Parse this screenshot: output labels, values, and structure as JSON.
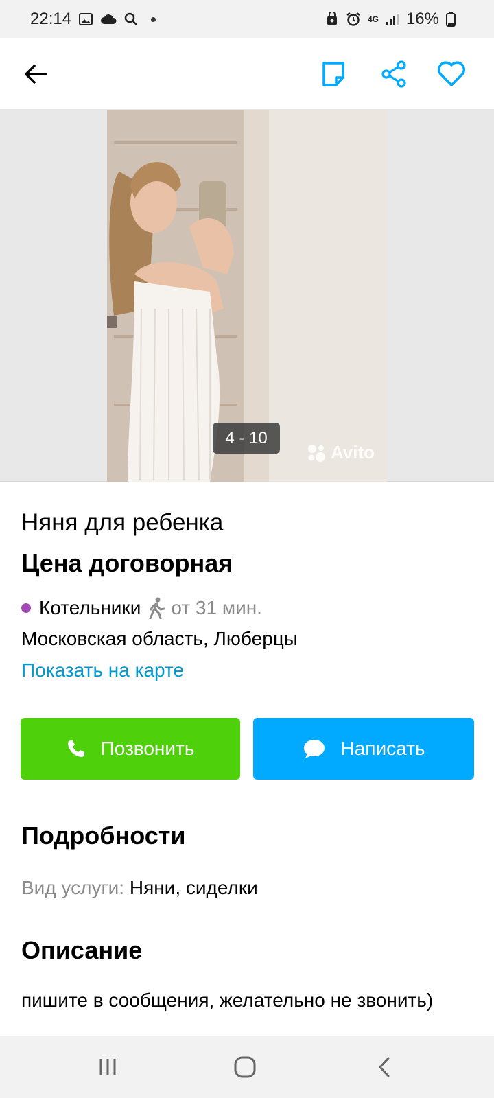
{
  "status_bar": {
    "time": "22:14",
    "network_top": "4G",
    "battery": "16%",
    "icons": [
      "image-icon",
      "cloud-icon",
      "search-icon",
      "dot-icon",
      "vpn-lock-icon",
      "alarm-icon",
      "data-arrows-icon",
      "signal-icon",
      "battery-icon"
    ]
  },
  "toolbar": {
    "icons": [
      "back-arrow-icon",
      "note-icon",
      "share-icon",
      "heart-icon"
    ],
    "accent": "#00aaff"
  },
  "gallery": {
    "counter": "4 - 10",
    "watermark": "Avito"
  },
  "listing": {
    "title": "Няня для ребенка",
    "price": "Цена договорная",
    "metro_station": "Котельники",
    "metro_time": "от 31 мин.",
    "metro_color": "#a247b4",
    "address": "Московская область, Люберцы",
    "map_link": "Показать на карте"
  },
  "actions": {
    "call_label": "Позвонить",
    "call_color": "#4ed00b",
    "write_label": "Написать",
    "write_color": "#02aaff"
  },
  "details": {
    "heading": "Подробности",
    "service_key": "Вид услуги:",
    "service_value": "Няни, сиделки"
  },
  "description": {
    "heading": "Описание",
    "text": "пишите в сообщения, желательно не звонить)"
  },
  "navbar": {
    "icons": [
      "recent-apps-icon",
      "home-icon",
      "back-icon"
    ]
  }
}
